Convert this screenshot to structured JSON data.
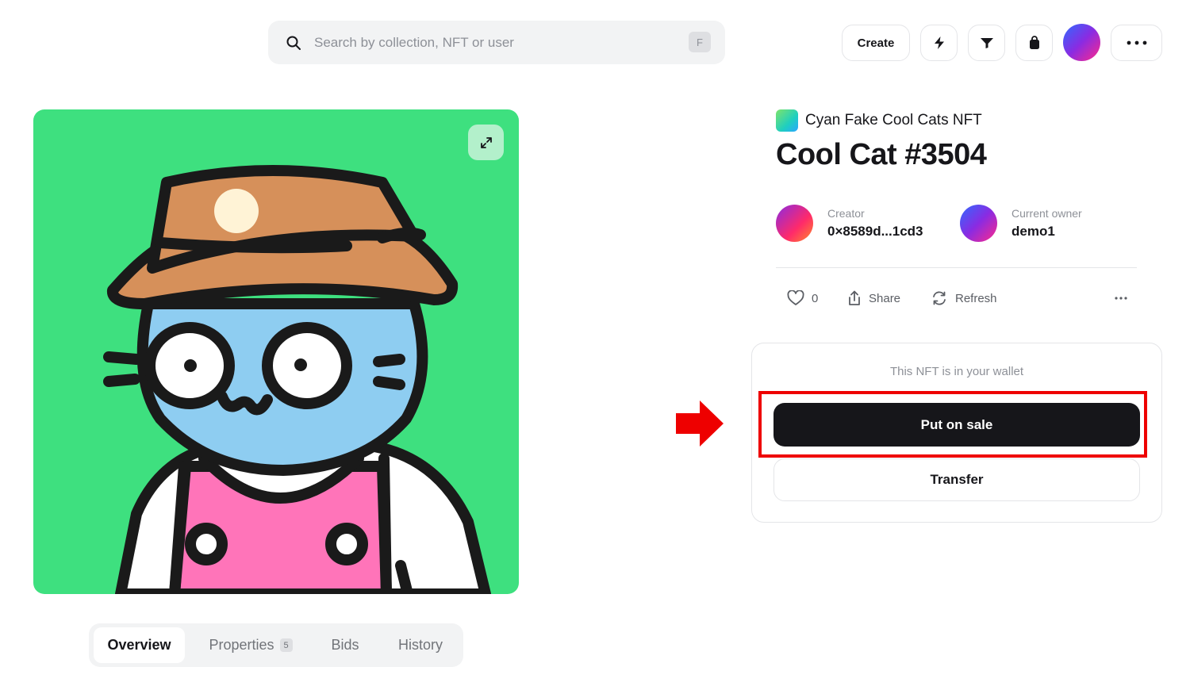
{
  "header": {
    "search_placeholder": "Search by collection, NFT or user",
    "search_shortcut": "F",
    "create_label": "Create",
    "icons": [
      "search-icon",
      "lightning-icon",
      "filter-icon",
      "bag-icon",
      "avatar",
      "more-icon"
    ]
  },
  "artwork": {
    "background_color": "#3ee07f",
    "expand_icon": "expand-icon"
  },
  "tabs": [
    {
      "label": "Overview",
      "active": true
    },
    {
      "label": "Properties",
      "count": "5"
    },
    {
      "label": "Bids"
    },
    {
      "label": "History"
    }
  ],
  "nft": {
    "collection": "Cyan Fake Cool Cats NFT",
    "title": "Cool Cat #3504",
    "creator_label": "Creator",
    "creator": "0×8589d...1cd3",
    "owner_label": "Current owner",
    "owner": "demo1"
  },
  "actions": {
    "likes": "0",
    "share_label": "Share",
    "refresh_label": "Refresh"
  },
  "wallet": {
    "note": "This NFT is in your wallet",
    "put_on_sale_label": "Put on sale",
    "transfer_label": "Transfer"
  },
  "colors": {
    "primary_button": "#16161a",
    "highlight": "#ee0000"
  }
}
